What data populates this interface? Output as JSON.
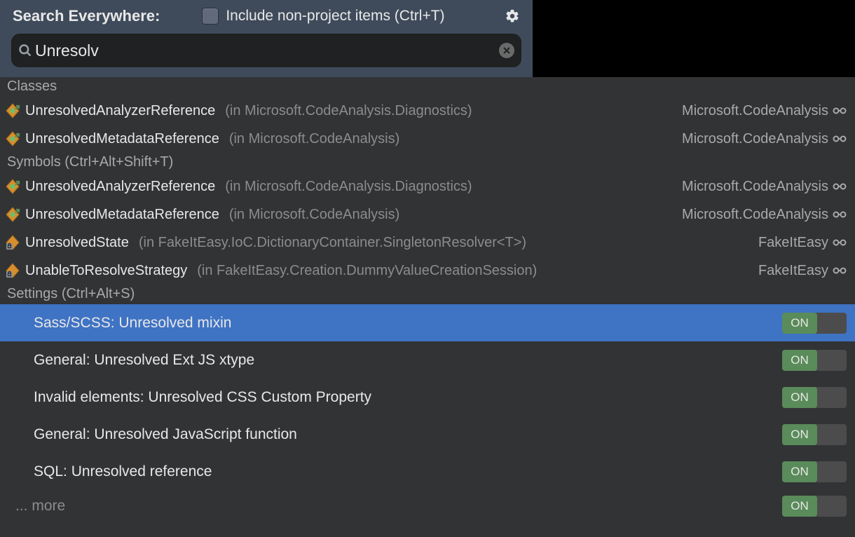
{
  "header": {
    "title": "Search Everywhere:",
    "include_label": "Include non-project items (Ctrl+T)"
  },
  "search": {
    "value": "Unresolv"
  },
  "sections": [
    {
      "title": "Classes",
      "rows": [
        {
          "icon": "class",
          "name": "UnresolvedAnalyzerReference",
          "meta": "(in Microsoft.CodeAnalysis.Diagnostics)",
          "assembly": "Microsoft.CodeAnalysis",
          "link": true
        },
        {
          "icon": "class",
          "name": "UnresolvedMetadataReference",
          "meta": "(in Microsoft.CodeAnalysis)",
          "assembly": "Microsoft.CodeAnalysis",
          "link": true
        }
      ]
    },
    {
      "title": "Symbols (Ctrl+Alt+Shift+T)",
      "rows": [
        {
          "icon": "class",
          "name": "UnresolvedAnalyzerReference",
          "meta": "(in Microsoft.CodeAnalysis.Diagnostics)",
          "assembly": "Microsoft.CodeAnalysis",
          "link": true
        },
        {
          "icon": "class",
          "name": "UnresolvedMetadataReference",
          "meta": "(in Microsoft.CodeAnalysis)",
          "assembly": "Microsoft.CodeAnalysis",
          "link": true
        },
        {
          "icon": "field",
          "name": "UnresolvedState",
          "meta": "(in FakeItEasy.IoC.DictionaryContainer.SingletonResolver<T>)",
          "assembly": "FakeItEasy",
          "link": true
        },
        {
          "icon": "field",
          "name": "UnableToResolveStrategy",
          "meta": "(in FakeItEasy.Creation.DummyValueCreationSession)",
          "assembly": "FakeItEasy",
          "link": true
        }
      ]
    }
  ],
  "settings": {
    "title": "Settings (Ctrl+Alt+S)",
    "rows": [
      {
        "label": "Sass/SCSS: Unresolved mixin",
        "state": "ON",
        "selected": true
      },
      {
        "label": "General: Unresolved Ext JS xtype",
        "state": "ON"
      },
      {
        "label": "Invalid elements: Unresolved CSS Custom Property",
        "state": "ON"
      },
      {
        "label": "General: Unresolved JavaScript function",
        "state": "ON"
      },
      {
        "label": "SQL: Unresolved reference",
        "state": "ON"
      }
    ],
    "more_label": "... more",
    "more_state": "ON"
  }
}
